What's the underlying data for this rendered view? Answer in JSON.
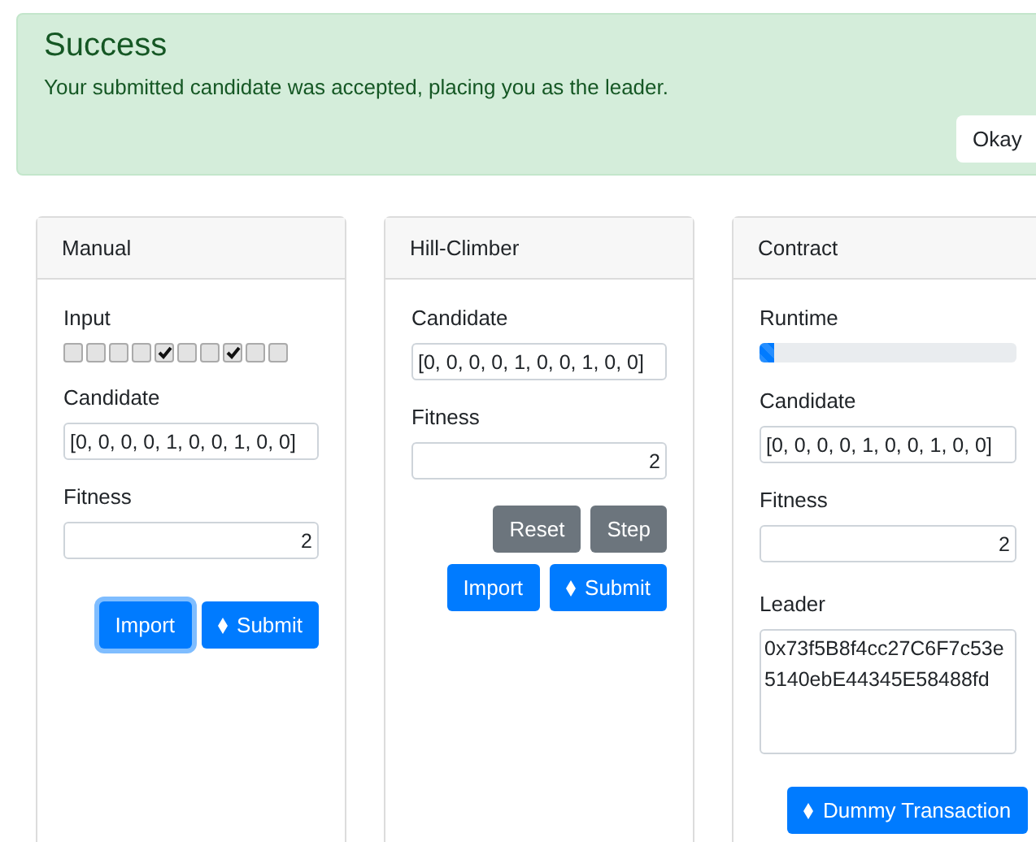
{
  "alert": {
    "title": "Success",
    "message": "Your submitted candidate was accepted, placing you as the leader.",
    "button": "Okay"
  },
  "manual": {
    "title": "Manual",
    "input_label": "Input",
    "bits": [
      {
        "checked": false
      },
      {
        "checked": false
      },
      {
        "checked": false
      },
      {
        "checked": false
      },
      {
        "checked": true
      },
      {
        "checked": false
      },
      {
        "checked": false
      },
      {
        "checked": true
      },
      {
        "checked": false
      },
      {
        "checked": false
      }
    ],
    "candidate_label": "Candidate",
    "candidate": "[0, 0, 0, 0, 1, 0, 0, 1, 0, 0]",
    "fitness_label": "Fitness",
    "fitness": "2",
    "buttons": [
      {
        "label": "Import",
        "kind": "plain",
        "focused": true
      },
      {
        "label": "Submit",
        "kind": "eth",
        "focused": false
      }
    ]
  },
  "hill_climber": {
    "title": "Hill-Climber",
    "candidate_label": "Candidate",
    "candidate": "[0, 0, 0, 0, 1, 0, 0, 1, 0, 0]",
    "fitness_label": "Fitness",
    "fitness": "2",
    "secondary_buttons": [
      "Reset",
      "Step"
    ],
    "buttons": [
      {
        "label": "Import",
        "kind": "plain",
        "focused": false
      },
      {
        "label": "Submit",
        "kind": "eth",
        "focused": false
      }
    ]
  },
  "contract": {
    "title": "Contract",
    "runtime_label": "Runtime",
    "runtime": {
      "level": 0.06
    },
    "candidate_label": "Candidate",
    "candidate": "[0, 0, 0, 0, 1, 0, 0, 1, 0, 0]",
    "fitness_label": "Fitness",
    "fitness": "2",
    "leader_label": "Leader",
    "leader": "0x73f5B8f4cc27C6F7c53e5140ebE44345E58488fd",
    "button": {
      "label": "Dummy Transaction",
      "kind": "eth",
      "focused": false
    }
  }
}
